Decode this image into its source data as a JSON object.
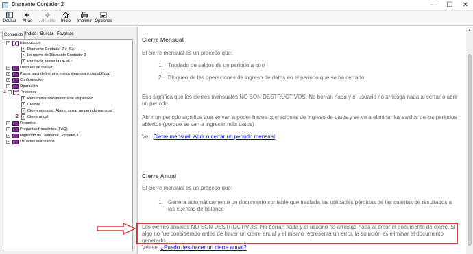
{
  "window": {
    "title": "Diamante Contador 2",
    "minimize": "—",
    "maximize": "☐",
    "close": "✕"
  },
  "toolbar": {
    "hide": "Ocultar",
    "back": "Atrás",
    "forward": "Adelante",
    "home": "Inicio",
    "print": "Imprimir",
    "options": "Opciones"
  },
  "tabs": {
    "contents": "Contenido",
    "index": "Índice",
    "search": "Buscar",
    "favorites": "Favoritos"
  },
  "tree": {
    "introduccion": "Introducción",
    "diamante_isa": "Diamante Contador 2 e ISA",
    "lo_nuevo": "Lo nuevo de Diamante Contador 2",
    "demo": "Por favor, revise la DEMO",
    "despues_instalar": "Después de instalar",
    "pasos": "Pasos para definir una nueva empresa o contabilidad",
    "configuracion": "Configuración",
    "operacion": "Operación",
    "procesos": "Procesos",
    "renumerar": "Renumerar documentos de un periodo",
    "cierres": "Cierres",
    "cierre_mensual": "Cierre mensual. Abrir o cerrar un periodo mensual",
    "cierre_anual": "Cierre anual",
    "reportes": "Reportes",
    "preguntas": "Preguntas frecuentes (FAQ)",
    "migrando": "Migrando de Diamante Contador 1",
    "usuarios": "Usuarios avanzados",
    "mark1": "1",
    "mark2": "2"
  },
  "content": {
    "mensual_title": "Cierre Mensual",
    "mensual_intro": "El cierre mensual es un proceso que:",
    "mensual_item1_num": "1.",
    "mensual_item1": "Traslado de saldos de un periodo a otro",
    "mensual_item2_num": "2.",
    "mensual_item2": "Bloqueo de las operaciones de ingreso de datos en el periodo que se ha cerrado.",
    "mensual_p1": "Eso significa que los cierres mensuales NO SON DESTRUCTIVOS.  No borran nada y el usuario no arriesga nada al cerrar o abrir un periodo.",
    "mensual_p2": "Abrir un periodo significa que se van a poder haces operaciones de ingreso de datos y se va a eliminar los saldos de los periodos abiertos (porque se van a ingresar más datos)",
    "ver_label": "Ver",
    "ver_link": "Cierre mensual. Abrir o cerrar un periodo mensual",
    "anual_title": "Cierre Anual",
    "anual_intro": "El cierre mensual es un proceso que:",
    "anual_item1_num": "1.",
    "anual_item1": "Genera automáticamente un documento contable que traslada las utilidades/pérdidas de las cuentas de resultados a las cuentas de balance",
    "anual_p1": "Los cierres anuales NO SON DESTRUCTIVOS. No borran nada y el usuario no arriesga nada al crear el documento de cierre. Si algo no fue considerado antes de hacer un cierre anual y el mismo representa un error, la solución es eliminar el documento generado.",
    "vease_label": "Véase",
    "vease_link": "¿Puedo des-hacer un cierre anual?"
  },
  "colors": {
    "highlight": "#d9383a",
    "link": "#0000cc",
    "book": "#7b2c8c"
  }
}
